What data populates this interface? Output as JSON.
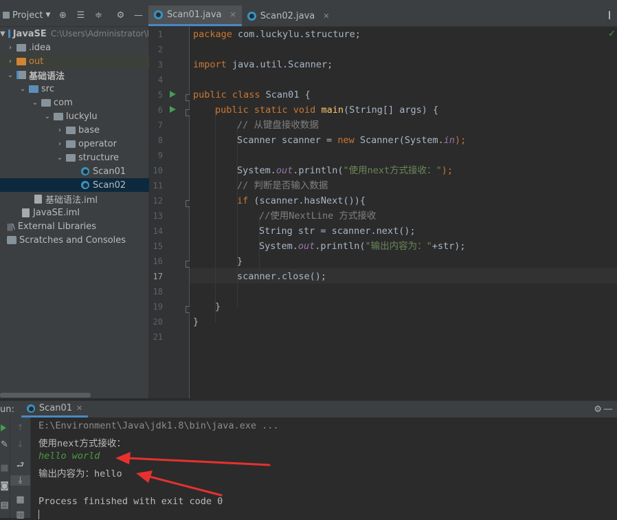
{
  "project_toolbar": {
    "title": "Project"
  },
  "tabs": [
    {
      "label": "Scan01.java",
      "active": true
    },
    {
      "label": "Scan02.java",
      "active": false
    }
  ],
  "tree": {
    "root_name": "JavaSE",
    "root_path": "C:\\Users\\Administrator\\I",
    "idea": ".idea",
    "out": "out",
    "module": "基础语法",
    "src": "src",
    "com": "com",
    "luckylu": "luckylu",
    "base": "base",
    "operator": "operator",
    "structure": "structure",
    "scan01": "Scan01",
    "scan02": "Scan02",
    "module_iml": "基础语法.iml",
    "javase_iml": "JavaSE.iml",
    "ext_libs": "External Libraries",
    "scratches": "Scratches and Consoles"
  },
  "editor": {
    "line_numbers": [
      "1",
      "2",
      "3",
      "4",
      "5",
      "6",
      "7",
      "8",
      "9",
      "10",
      "11",
      "12",
      "13",
      "14",
      "15",
      "16",
      "17",
      "18",
      "19",
      "20",
      "21"
    ],
    "current_line": "17",
    "code": {
      "l1_kw": "package",
      "l1_rest": " com.luckylu.structure;",
      "l3_kw": "import",
      "l3_rest": " java.util.Scanner;",
      "l5_kw": "public class",
      "l5_rest": " Scan01 {",
      "l6_kw": "public static void",
      "l6_fn": "main",
      "l6_rest": "(String[] args) {",
      "l7_cm": "// 从键盘接收数据",
      "l8_a": "Scanner scanner = ",
      "l8_kw": "new",
      "l8_b": " Scanner(System.",
      "l8_st": "in",
      "l8_c": ");",
      "l10_a": "System.",
      "l10_st": "out",
      "l10_b": ".println(",
      "l10_str": "\"使用next方式接收：\"",
      "l10_c": ");",
      "l11_cm": "// 判断是否输入数据",
      "l12_kw": "if",
      "l12_rest": " (scanner.hasNext()){",
      "l13_cm": "//使用NextLine 方式接收",
      "l14": "String str = scanner.next();",
      "l15_a": "System.",
      "l15_st": "out",
      "l15_b": ".println(",
      "l15_str": "\"输出内容为：\"",
      "l15_c": "+str);",
      "l16": "}",
      "l17": "scanner.close();",
      "l19": "}",
      "l20": "}"
    }
  },
  "run": {
    "label": "un:",
    "tab": "Scan01",
    "console": {
      "cmd": "E:\\Environment\\Java\\jdk1.8\\bin\\java.exe ...",
      "prompt": "使用next方式接收：",
      "input": "hello world",
      "output": "输出内容为：hello",
      "finished": "Process finished with exit code 0"
    }
  },
  "colors": {
    "arrow": "#e8312f",
    "accent": "#4a88c7"
  }
}
